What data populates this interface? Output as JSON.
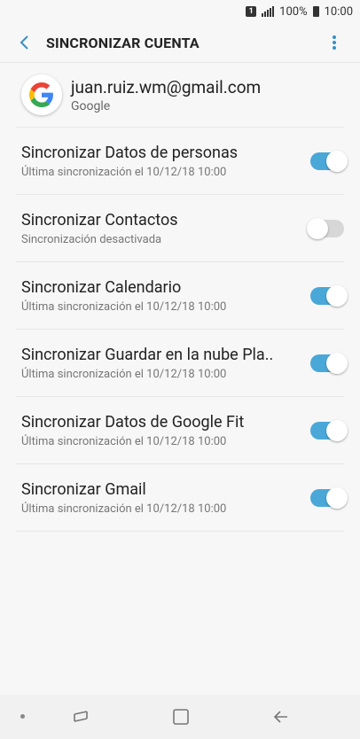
{
  "status_bar": {
    "sim": "1",
    "battery": "100%",
    "time": "10:00"
  },
  "app_bar": {
    "title": "SINCRONIZAR CUENTA"
  },
  "account": {
    "email": "juan.ruiz.wm@gmail.com",
    "type": "Google"
  },
  "sync_items": [
    {
      "title": "Sincronizar Datos de personas",
      "subtitle": "Última sincronización el 10/12/18  10:00",
      "enabled": true
    },
    {
      "title": "Sincronizar Contactos",
      "subtitle": "Sincronización desactivada",
      "enabled": false
    },
    {
      "title": "Sincronizar Calendario",
      "subtitle": "Última sincronización el 10/12/18  10:00",
      "enabled": true
    },
    {
      "title": "Sincronizar Guardar en la nube Pla..",
      "subtitle": "Última sincronización el 10/12/18  10:00",
      "enabled": true
    },
    {
      "title": "Sincronizar Datos de Google Fit",
      "subtitle": "Última sincronización el 10/12/18  10:00",
      "enabled": true
    },
    {
      "title": "Sincronizar Gmail",
      "subtitle": "Última sincronización el 10/12/18  10:00",
      "enabled": true
    }
  ],
  "colors": {
    "toggle_on": "#4aa8d8",
    "toggle_off": "#d7d7d7",
    "accent": "#3a8fc6"
  },
  "icons": {
    "back": "back-arrow-icon",
    "more": "more-vert-icon",
    "nav_recent": "recent-apps-icon",
    "nav_home": "home-icon",
    "nav_back": "nav-back-icon"
  }
}
